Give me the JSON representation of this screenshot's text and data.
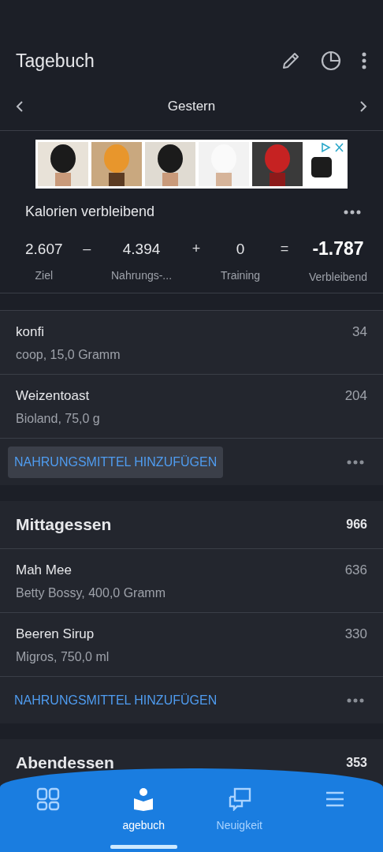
{
  "header": {
    "title": "Tagebuch"
  },
  "date_nav": {
    "label": "Gestern"
  },
  "summary": {
    "title": "Kalorien verbleibend",
    "items": [
      {
        "kind": "value",
        "value": "2.607",
        "label": "Ziel"
      },
      {
        "kind": "operator",
        "value": "–"
      },
      {
        "kind": "value",
        "value": "4.394",
        "label": "Nahrungs-..."
      },
      {
        "kind": "operator",
        "value": "+"
      },
      {
        "kind": "value",
        "value": "0",
        "label": "Training"
      },
      {
        "kind": "operator",
        "value": "="
      },
      {
        "kind": "result",
        "value": "-1.787",
        "label": "Verbleibend"
      }
    ]
  },
  "meals": [
    {
      "entries": [
        {
          "name": "konfi",
          "detail": "coop, 15,0 Gramm",
          "calories": "34"
        },
        {
          "name": "Weizentoast",
          "detail": "Bioland, 75,0 g",
          "calories": "204"
        }
      ],
      "add_label": "NAHRUNGSMITTEL HINZUFÜGEN",
      "add_pressed": true
    },
    {
      "name": "Mittagessen",
      "total": "966",
      "entries": [
        {
          "name": "Mah Mee",
          "detail": "Betty Bossy, 400,0 Gramm",
          "calories": "636"
        },
        {
          "name": "Beeren Sirup",
          "detail": "Migros, 750,0 ml",
          "calories": "330"
        }
      ],
      "add_label": "NAHRUNGSMITTEL HINZUFÜGEN",
      "add_pressed": false
    },
    {
      "name": "Abendessen",
      "total": "353"
    }
  ],
  "bottom_nav": [
    {
      "kind": "dashboard",
      "selected": false
    },
    {
      "kind": "diary",
      "label": "agebuch",
      "selected": true
    },
    {
      "kind": "news",
      "label": "Neuigkeit",
      "selected": false
    },
    {
      "kind": "menu",
      "selected": false
    }
  ]
}
